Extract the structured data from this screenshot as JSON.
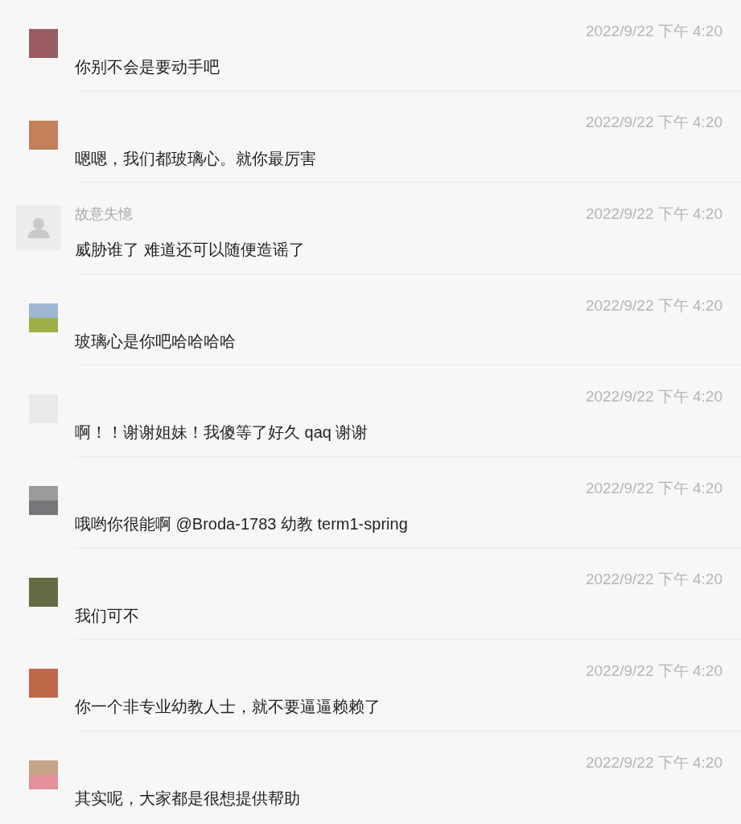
{
  "comments": [
    {
      "avatar": {
        "kind": "pixelated"
      },
      "time": "2022/9/22 下午 4:20",
      "message": "你别不会是要动手吧"
    },
    {
      "avatar": {
        "kind": "pixelated"
      },
      "time": "2022/9/22 下午 4:20",
      "message": "嗯嗯，我们都玻璃心。就你最厉害"
    },
    {
      "avatar": {
        "kind": "default"
      },
      "name": "故意失憶",
      "time": "2022/9/22 下午 4:20",
      "message": "威胁谁了 难道还可以随便造谣了"
    },
    {
      "avatar": {
        "kind": "pixelated"
      },
      "time": "2022/9/22 下午 4:20",
      "message": "玻璃心是你吧哈哈哈哈"
    },
    {
      "avatar": {
        "kind": "pixelated"
      },
      "time": "2022/9/22 下午 4:20",
      "message": "啊！！谢谢姐妹！我傻等了好久 qaq 谢谢"
    },
    {
      "avatar": {
        "kind": "pixelated"
      },
      "time": "2022/9/22 下午 4:20",
      "message": "哦哟你很能啊 @Broda-1783 幼教 term1-spring"
    },
    {
      "avatar": {
        "kind": "pixelated"
      },
      "time": "2022/9/22 下午 4:20",
      "message": "我们可不"
    },
    {
      "avatar": {
        "kind": "pixelated"
      },
      "time": "2022/9/22 下午 4:20",
      "message": "你一个非专业幼教人士，就不要逼逼赖赖了"
    },
    {
      "avatar": {
        "kind": "pixelated"
      },
      "time": "2022/9/22 下午 4:20",
      "message": "其实呢，大家都是很想提供帮助"
    }
  ]
}
